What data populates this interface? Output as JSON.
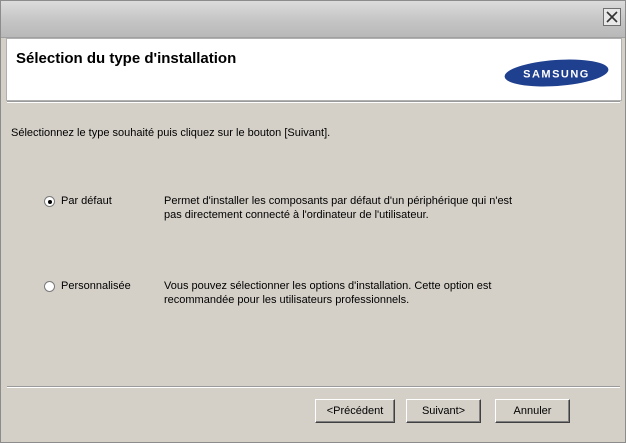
{
  "window": {
    "header_title": "Sélection du type d'installation",
    "logo_text": "SAMSUNG",
    "instruction": "Sélectionnez le type souhaité puis cliquez sur le bouton [Suivant]."
  },
  "options": [
    {
      "label": "Par défaut",
      "selected": true,
      "description_line1": "Permet d'installer les composants par défaut d'un périphérique qui n'est",
      "description_line2": "pas directement connecté à l'ordinateur de l'utilisateur."
    },
    {
      "label": "Personnalisée",
      "selected": false,
      "description_line1": "Vous pouvez sélectionner les options d'installation. Cette option est",
      "description_line2": "recommandée pour les utilisateurs professionnels."
    }
  ],
  "buttons": {
    "back": "<Précédent",
    "next": "Suivant>",
    "cancel": "Annuler"
  },
  "icons": {
    "close": "close-icon",
    "logo": "samsung-logo"
  },
  "colors": {
    "dialog_bg": "#d4d0c8",
    "logo_blue": "#1f3f8f"
  }
}
